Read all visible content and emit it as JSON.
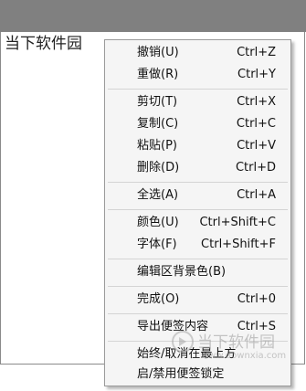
{
  "note": {
    "text": "当下软件园"
  },
  "menu": {
    "items": [
      {
        "label": "撤销(U)",
        "shortcut": "Ctrl+Z"
      },
      {
        "label": "重做(R)",
        "shortcut": "Ctrl+Y"
      },
      {
        "label": "剪切(T)",
        "shortcut": "Ctrl+X"
      },
      {
        "label": "复制(C)",
        "shortcut": "Ctrl+C"
      },
      {
        "label": "粘贴(P)",
        "shortcut": "Ctrl+V"
      },
      {
        "label": "删除(D)",
        "shortcut": "Ctrl+D"
      },
      {
        "label": "全选(A)",
        "shortcut": "Ctrl+A"
      },
      {
        "label": "颜色(U)",
        "shortcut": "Ctrl+Shift+C"
      },
      {
        "label": "字体(F)",
        "shortcut": "Ctrl+Shift+F"
      },
      {
        "label": "编辑区背景色(B)",
        "shortcut": ""
      },
      {
        "label": "完成(O)",
        "shortcut": "Ctrl+0"
      },
      {
        "label": "导出便签内容",
        "shortcut": "Ctrl+S"
      },
      {
        "label": "始终/取消在最上方",
        "shortcut": ""
      },
      {
        "label": "启/禁用便签锁定",
        "shortcut": ""
      }
    ]
  },
  "watermark": {
    "name": "当下软件园",
    "url": "www.downxia.com"
  },
  "colors": {
    "titlebar": "#808080",
    "menu_bg": "#f5f5f5",
    "separator": "#d4d4d4"
  }
}
